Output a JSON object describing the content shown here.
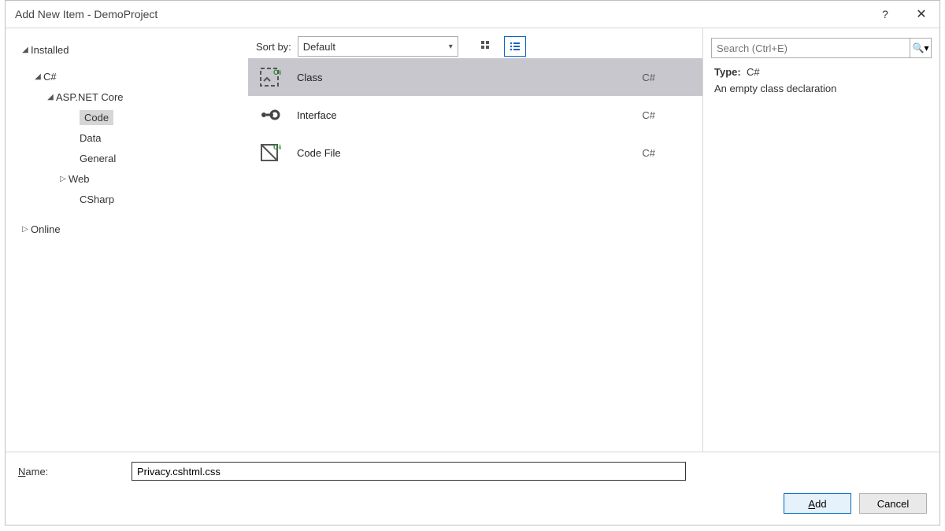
{
  "titlebar": {
    "title": "Add New Item - DemoProject"
  },
  "sidebar": {
    "rows": [
      {
        "label": "Installed",
        "indent": 0,
        "arrow": "▾",
        "selected": false
      },
      {
        "label": "C#",
        "indent": 1,
        "arrow": "▾",
        "selected": false
      },
      {
        "label": "ASP.NET Core",
        "indent": 2,
        "arrow": "▾",
        "selected": false
      },
      {
        "label": "Code",
        "indent": 3,
        "arrow": "",
        "selected": true
      },
      {
        "label": "Data",
        "indent": 3,
        "arrow": "",
        "selected": false
      },
      {
        "label": "General",
        "indent": 3,
        "arrow": "",
        "selected": false
      },
      {
        "label": "Web",
        "indent": 3,
        "arrow": "▹",
        "selected": false
      },
      {
        "label": "CSharp",
        "indent": 3,
        "arrow": "",
        "selected": false
      },
      {
        "label": "Online",
        "indent": 0,
        "arrow": "▹",
        "selected": false
      }
    ]
  },
  "center": {
    "sort_label": "Sort by:",
    "sort_value": "Default",
    "items": [
      {
        "label": "Class",
        "lang": "C#",
        "selected": true
      },
      {
        "label": "Interface",
        "lang": "C#",
        "selected": false
      },
      {
        "label": "Code File",
        "lang": "C#",
        "selected": false
      }
    ]
  },
  "details": {
    "search_placeholder": "Search (Ctrl+E)",
    "type_label": "Type:",
    "type_value": "C#",
    "description": "An empty class declaration"
  },
  "footer": {
    "name_label_first": "N",
    "name_label_rest": "ame:",
    "name_value": "Privacy.cshtml.css",
    "add_first": "A",
    "add_rest": "dd",
    "cancel": "Cancel"
  }
}
